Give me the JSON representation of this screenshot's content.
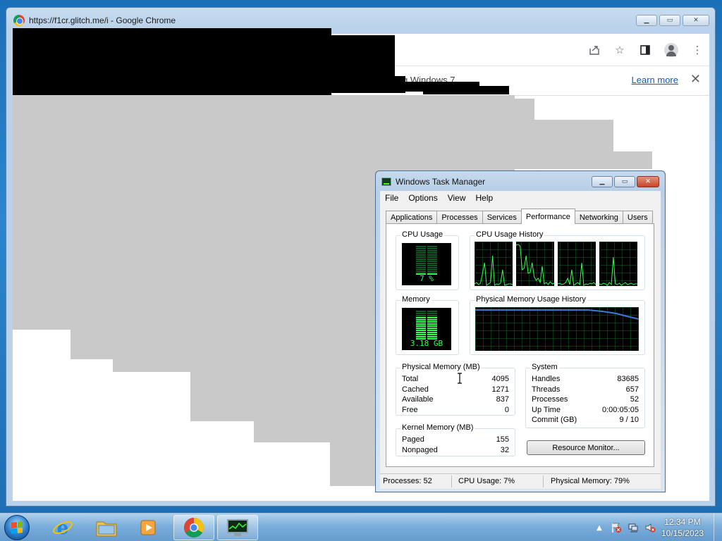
{
  "chrome": {
    "title": "https://f1cr.glitch.me/i - Google Chrome",
    "infobar_text": "g Windows 7.",
    "learn_more": "Learn more",
    "close_glyph": "✕"
  },
  "task_manager": {
    "title": "Windows Task Manager",
    "menu": [
      "File",
      "Options",
      "View",
      "Help"
    ],
    "tabs": [
      "Applications",
      "Processes",
      "Services",
      "Performance",
      "Networking",
      "Users"
    ],
    "active_tab": "Performance",
    "cpu_usage": {
      "label": "CPU Usage",
      "value": "7 %"
    },
    "cpu_history_label": "CPU Usage History",
    "memory": {
      "label": "Memory",
      "value": "3.18 GB"
    },
    "mem_history_label": "Physical Memory Usage History",
    "physical_memory": {
      "label": "Physical Memory (MB)",
      "rows": [
        {
          "k": "Total",
          "v": "4095"
        },
        {
          "k": "Cached",
          "v": "1271"
        },
        {
          "k": "Available",
          "v": "837"
        },
        {
          "k": "Free",
          "v": "0"
        }
      ]
    },
    "kernel_memory": {
      "label": "Kernel Memory (MB)",
      "rows": [
        {
          "k": "Paged",
          "v": "155"
        },
        {
          "k": "Nonpaged",
          "v": "32"
        }
      ]
    },
    "system": {
      "label": "System",
      "rows": [
        {
          "k": "Handles",
          "v": "83685"
        },
        {
          "k": "Threads",
          "v": "657"
        },
        {
          "k": "Processes",
          "v": "52"
        },
        {
          "k": "Up Time",
          "v": "0:00:05:05"
        },
        {
          "k": "Commit (GB)",
          "v": "9 / 10"
        }
      ]
    },
    "resource_monitor_button": "Resource Monitor...",
    "status": {
      "processes": "Processes: 52",
      "cpu": "CPU Usage: 7%",
      "memory": "Physical Memory: 79%"
    }
  },
  "taskbar": {
    "time": "12:34 PM",
    "date": "10/15/2023",
    "pinned": [
      "internet-explorer",
      "windows-explorer",
      "media-player",
      "chrome",
      "task-manager"
    ]
  },
  "colors": {
    "graph_green": "#31ff4d",
    "graph_grid": "#0a6b33",
    "mem_line": "#3a7bd5"
  }
}
